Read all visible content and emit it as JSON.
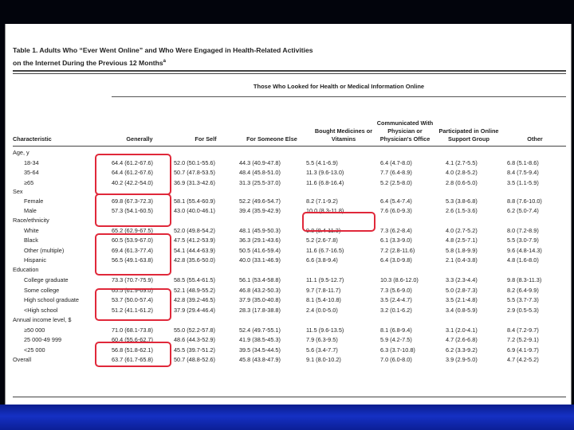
{
  "table": {
    "title_line1": "Table 1. Adults Who “Ever Went Online” and Who Were Engaged in Health-Related Activities",
    "title_line2": "on the Internet During the Previous 12 Months",
    "title_footnote": "a",
    "spanner": "Those Who Looked for Health or Medical Information Online",
    "columns": [
      "Characteristic",
      "Generally",
      "For Self",
      "For Someone Else",
      "Bought Medicines or Vitamins",
      "Communicated With Physician or Physician's Office",
      "Participated in Online Support Group",
      "Other"
    ],
    "rows": [
      {
        "label": "Age, y",
        "indent": 0,
        "values": []
      },
      {
        "label": "18-34",
        "indent": 1,
        "values": [
          "64.4 (61.2-67.6)",
          "52.0 (50.1-55.6)",
          "44.3 (40.9-47.8)",
          "5.5 (4.1-6.9)",
          "6.4 (4.7-8.0)",
          "4.1 (2.7-5.5)",
          "6.8 (5.1-8.6)"
        ]
      },
      {
        "label": "35-64",
        "indent": 1,
        "values": [
          "64.4 (61.2-67.6)",
          "50.7 (47.8-53.5)",
          "48.4 (45.8-51.0)",
          "11.3 (9.6-13.0)",
          "7.7 (6.4-8.9)",
          "4.0 (2.8-5.2)",
          "8.4 (7.5-9.4)"
        ]
      },
      {
        "label": "≥65",
        "indent": 1,
        "values": [
          "40.2 (42.2-54.0)",
          "36.9 (31.3-42.6)",
          "31.3 (25.5-37.0)",
          "11.6 (6.8-16.4)",
          "5.2 (2.5-8.0)",
          "2.8 (0.6-5.0)",
          "3.5 (1.1-5.9)"
        ]
      },
      {
        "label": "Sex",
        "indent": 0,
        "values": []
      },
      {
        "label": "Female",
        "indent": 1,
        "values": [
          "69.8 (67.3-72.3)",
          "58.1 (55.4-60.9)",
          "52.2 (49.6-54.7)",
          "8.2 (7.1-9.2)",
          "6.4 (5.4-7.4)",
          "5.3 (3.8-6.8)",
          "8.8 (7.6-10.0)"
        ]
      },
      {
        "label": "Male",
        "indent": 1,
        "values": [
          "57.3 (54.1-60.5)",
          "43.0 (40.0-46.1)",
          "39.4 (35.9-42.9)",
          "10.0 (8.3-11.8)",
          "7.6 (6.0-9.3)",
          "2.6 (1.5-3.6)",
          "6.2 (5.0-7.4)"
        ]
      },
      {
        "label": "Race/ethnicity",
        "indent": 0,
        "values": []
      },
      {
        "label": "White",
        "indent": 1,
        "values": [
          "65.2 (62.9-67.5)",
          "52.0 (49.8-54.2)",
          "48.1 (45.9-50.3)",
          "9.8 (8.4-11.3)",
          "7.3 (6.2-8.4)",
          "4.0 (2.7-5.2)",
          "8.0 (7.2-8.9)"
        ]
      },
      {
        "label": "Black",
        "indent": 1,
        "values": [
          "60.5 (53.9-67.0)",
          "47.5 (41.2-53.9)",
          "36.3 (29.1-43.6)",
          "5.2 (2.6-7.8)",
          "6.1 (3.3-9.0)",
          "4.8 (2.5-7.1)",
          "5.5 (3.0-7.9)"
        ]
      },
      {
        "label": "Other (multiple)",
        "indent": 1,
        "values": [
          "69.4 (61.3-77.4)",
          "54.1 (44.4-63.9)",
          "50.5 (41.6-59.4)",
          "11.6 (6.7-16.5)",
          "7.2 (2.8-11.6)",
          "5.8 (1.8-9.9)",
          "9.6 (4.8-14.3)"
        ]
      },
      {
        "label": "Hispanic",
        "indent": 1,
        "values": [
          "56.5 (49.1-63.8)",
          "42.8 (35.6-50.0)",
          "40.0 (33.1-46.9)",
          "6.6 (3.8-9.4)",
          "6.4 (3.0-9.8)",
          "2.1 (0.4-3.8)",
          "4.8 (1.6-8.0)"
        ]
      },
      {
        "label": "Education",
        "indent": 0,
        "values": []
      },
      {
        "label": "College graduate",
        "indent": 1,
        "values": [
          "73.3 (70.7-75.9)",
          "58.5 (55.4-61.5)",
          "56.1 (53.4-58.8)",
          "11.1 (9.5-12.7)",
          "10.3 (8.6-12.0)",
          "3.3 (2.3-4.4)",
          "9.8 (8.3-11.3)"
        ]
      },
      {
        "label": "Some college",
        "indent": 1,
        "values": [
          "65.5 (61.9-69.0)",
          "52.1 (48.9-55.2)",
          "46.8 (43.2-50.3)",
          "9.7 (7.8-11.7)",
          "7.3 (5.6-9.0)",
          "5.0 (2.8-7.3)",
          "8.2 (6.4-9.9)"
        ]
      },
      {
        "label": "High school graduate",
        "indent": 1,
        "values": [
          "53.7 (50.0-57.4)",
          "42.8 (39.2-46.5)",
          "37.9 (35.0-40.8)",
          "8.1 (5.4-10.8)",
          "3.5 (2.4-4.7)",
          "3.5 (2.1-4.8)",
          "5.5 (3.7-7.3)"
        ]
      },
      {
        "label": "<High school",
        "indent": 1,
        "values": [
          "51.2 (41.1-61.2)",
          "37.9 (29.4-46.4)",
          "28.3 (17.8-38.8)",
          "2.4 (0.0-5.0)",
          "3.2 (0.1-6.2)",
          "3.4 (0.8-5.9)",
          "2.9 (0.5-5.3)"
        ]
      },
      {
        "label": "Annual income level, $",
        "indent": 0,
        "values": []
      },
      {
        "label": "≥50 000",
        "indent": 1,
        "values": [
          "71.0 (68.1-73.8)",
          "55.0 (52.2-57.8)",
          "52.4 (49.7-55.1)",
          "11.5 (9.6-13.5)",
          "8.1 (6.8-9.4)",
          "3.1 (2.0-4.1)",
          "8.4 (7.2-9.7)"
        ]
      },
      {
        "label": "25 000-49 999",
        "indent": 1,
        "values": [
          "60.4 (55.6-62.7)",
          "48.6 (44.3-52.9)",
          "41.9 (38.5-45.3)",
          "7.9 (6.3-9.5)",
          "5.9 (4.2-7.5)",
          "4.7 (2.6-6.8)",
          "7.2 (5.2-9.1)"
        ]
      },
      {
        "label": "<25 000",
        "indent": 1,
        "values": [
          "56.8 (51.8-62.1)",
          "45.5 (39.7-51.2)",
          "39.5 (34.5-44.5)",
          "5.6 (3.4-7.7)",
          "6.3 (3.7-10.8)",
          "6.2 (3.3-9.2)",
          "6.9 (4.1-9.7)"
        ]
      },
      {
        "label": "Overall",
        "indent": 0,
        "values": [
          "63.7 (61.7-65.8)",
          "50.7 (48.8-52.6)",
          "45.8 (43.8-47.9)",
          "9.1 (8.0-10.2)",
          "7.0 (6.0-8.0)",
          "3.9 (2.9-5.0)",
          "4.7 (4.2-5.2)"
        ]
      }
    ]
  },
  "colors": {
    "highlight": "#e0283a",
    "bottom_bar": "#1530c4"
  }
}
